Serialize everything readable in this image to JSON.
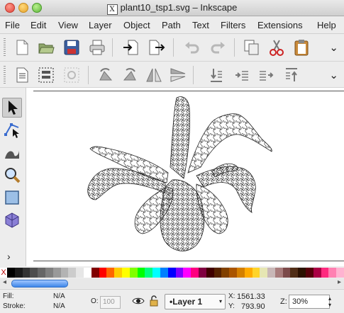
{
  "window": {
    "title": "plant10_tsp1.svg – Inkscape",
    "x_glyph": "X"
  },
  "menu": [
    "File",
    "Edit",
    "View",
    "Layer",
    "Object",
    "Path",
    "Text",
    "Filters",
    "Extensions",
    "Help"
  ],
  "toolbox": {
    "more": "›"
  },
  "palette": {
    "none_glyph": "X",
    "colors": [
      "#000000",
      "#1a1a1a",
      "#333333",
      "#4d4d4d",
      "#666666",
      "#808080",
      "#999999",
      "#b3b3b3",
      "#cccccc",
      "#e6e6e6",
      "#ffffff",
      "#800000",
      "#ff0000",
      "#ff6600",
      "#ffcc00",
      "#ffff00",
      "#80ff00",
      "#00ff00",
      "#00ff80",
      "#00ffff",
      "#0080ff",
      "#0000ff",
      "#8000ff",
      "#ff00ff",
      "#ff0080",
      "#800040",
      "#400000",
      "#552200",
      "#804000",
      "#aa5500",
      "#d47f00",
      "#ffaa00",
      "#ffd42a",
      "#e6e6b3",
      "#c8b7b7",
      "#a87c7c",
      "#7c4a4a",
      "#502d16",
      "#2b1100",
      "#55000a",
      "#aa0044",
      "#ff2a7f",
      "#ff80b2",
      "#ffb3d1"
    ]
  },
  "status": {
    "fill_label": "Fill:",
    "fill_value": "N/A",
    "stroke_label": "Stroke:",
    "stroke_value": "N/A",
    "opacity_label": "O:",
    "opacity_value": "100",
    "layer": "•Layer 1",
    "x_label": "X:",
    "x_value": "1561.33",
    "y_label": "Y:",
    "y_value": "793.90",
    "zoom_label": "Z:",
    "zoom_value": "30%"
  }
}
